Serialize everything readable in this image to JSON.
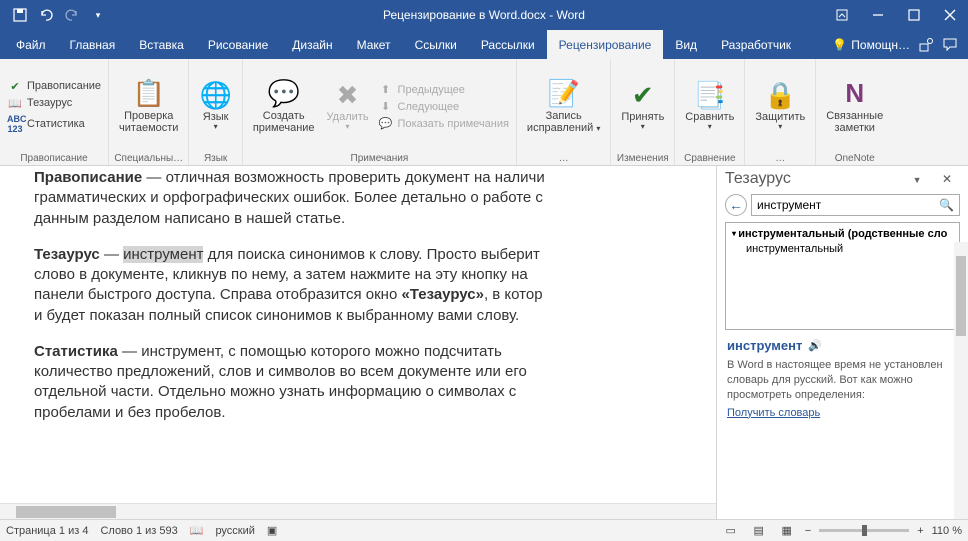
{
  "title": "Рецензирование в Word.docx - Word",
  "ribbon_tabs": [
    "Файл",
    "Главная",
    "Вставка",
    "Рисование",
    "Дизайн",
    "Макет",
    "Ссылки",
    "Рассылки",
    "Рецензирование",
    "Вид",
    "Разработчик"
  ],
  "tell_me": "Помощн…",
  "groups": {
    "proofing": {
      "label": "Правописание",
      "spelling": "Правописание",
      "thesaurus": "Тезаурус",
      "statistics": "Статистика",
      "readability1": "Проверка",
      "readability2": "читаемости"
    },
    "special": {
      "label": "Специальны…"
    },
    "language": {
      "label": "Язык",
      "btn": "Язык"
    },
    "comments": {
      "label": "Примечания",
      "new": "Создать",
      "new2": "примечание",
      "delete": "Удалить",
      "prev": "Предыдущее",
      "next": "Следующее",
      "show": "Показать примечания"
    },
    "tracking": {
      "label": "…",
      "track1": "Запись",
      "track2": "исправлений"
    },
    "changes": {
      "label": "Изменения",
      "accept": "Принять"
    },
    "compare": {
      "label": "Сравнение",
      "compare": "Сравнить"
    },
    "protect": {
      "label": "…",
      "protect": "Защитить"
    },
    "onenote": {
      "label": "OneNote",
      "notes1": "Связанные",
      "notes2": "заметки"
    }
  },
  "document": {
    "p1_bold": "Правописание",
    "p1_rest": " — отличная возможность проверить документ на наличи",
    "p1_line2": "грамматических и орфографических ошибок. Более детально о работе с",
    "p1_line3": "данным разделом написано в нашей статье.",
    "p2_bold": "Тезаурус",
    "p2_a": " — ",
    "p2_sel": "инструмент",
    "p2_b": " для поиска синонимов к слову. Просто выберит",
    "p2_line2": "слово в документе, кликнув по нему, а затем нажмите на эту кнопку на ",
    "p2_line3a": "панели быстрого доступа. Справа отобразится окно ",
    "p2_line3bold": "«Тезаурус»",
    "p2_line3b": ", в котор",
    "p2_line4": "и будет показан полный список синонимов к выбранному вами слову.",
    "p3_bold": "Статистика",
    "p3_a": " — инструмент, с помощью которого можно подсчитать ",
    "p3_line2": "количество предложений, слов и символов во всем документе или его ",
    "p3_line3": "отдельной части. Отдельно можно узнать информацию о символах с ",
    "p3_line4": "пробелами и без пробелов."
  },
  "pane": {
    "title": "Тезаурус",
    "search_value": "инструмент",
    "result_header": "инструментальный (родственные сло",
    "result_1": "инструментальный",
    "word": "инструмент",
    "desc": "В Word в настоящее время не установлен словарь для русский. Вот как можно просмотреть определения:",
    "link": "Получить словарь"
  },
  "status": {
    "page": "Страница 1 из 4",
    "words": "Слово 1 из 593",
    "lang": "русский",
    "zoom": "110 %"
  }
}
